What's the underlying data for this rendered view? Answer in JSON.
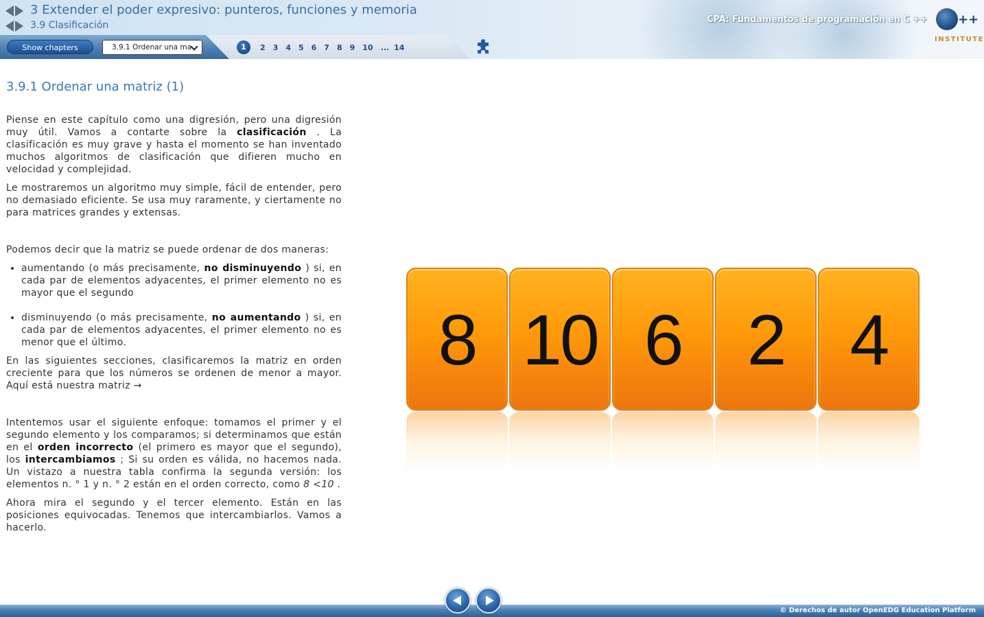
{
  "header": {
    "chapter_title": "3 Extender el poder expresivo: punteros, funciones y memoria",
    "section_title": "3.9 Clasificación",
    "course_title": "CPA: Fundamentos de programación en C ++",
    "logo_text": "INSTITUTE",
    "logo_plus": "++"
  },
  "toolbar": {
    "show_chapters_label": "Show chapters",
    "section_select_value": "3.9.1 Ordenar una ma",
    "pages": [
      "1",
      "2",
      "3",
      "4",
      "5",
      "6",
      "7",
      "8",
      "9",
      "10",
      "...",
      "14"
    ],
    "active_page": "1"
  },
  "content": {
    "title": "3.9.1 Ordenar una matriz (1)",
    "p1_a": "Piense en este capítulo como una digresión, pero una digresión muy útil. Vamos a contarte sobre la ",
    "p1_b": "clasificación",
    "p1_c": " . La clasificación es muy grave y hasta el momento se han inventado muchos algoritmos de clasificación que difieren mucho en velocidad y complejidad.",
    "p2": "Le mostraremos un algoritmo muy simple, fácil de entender, pero no demasiado eficiente. Se usa muy raramente, y ciertamente no para matrices grandes y extensas.",
    "p3": "Podemos decir que la matriz se puede ordenar de dos maneras:",
    "li1_a": "aumentando (o más precisamente, ",
    "li1_b": "no disminuyendo",
    "li1_c": " ) si, en cada par de elementos adyacentes, el primer elemento no es mayor que el segundo",
    "li2_a": "disminuyendo (o más precisamente, ",
    "li2_b": "no aumentando",
    "li2_c": " ) si, en cada par de elementos adyacentes, el primer elemento no es menor que el último.",
    "p4": "En las siguientes secciones, clasificaremos la matriz en orden creciente para que los números se ordenen de menor a mayor. Aquí está nuestra matriz →",
    "p5_a": "Intentemos usar el siguiente enfoque: tomamos el primer y el segundo elemento y los comparamos; si determinamos que están en el ",
    "p5_b": "orden incorrecto",
    "p5_c": " (el primero es mayor que el segundo), los ",
    "p5_d": "intercambiamos",
    "p5_e": " ; Si su orden es válida, no hacemos nada. Un vistazo a nuestra tabla confirma la segunda versión: los elementos n. ° 1 y n. ° 2 están en el orden correcto, como ",
    "p5_f": "8 <10",
    "p5_g": " .",
    "p6": "Ahora mira el segundo y el tercer elemento. Están en las posiciones equivocadas. Tenemos que intercambiarlos. Vamos a hacerlo."
  },
  "array_cards": [
    "8",
    "10",
    "6",
    "2",
    "4"
  ],
  "footer": {
    "copyright": "© Derechos de autor OpenEDG Education Platform"
  },
  "colors": {
    "card_orange": "#ff9a0a",
    "accent_blue": "#3c78b0",
    "toolbar_blue": "#4e7fb2"
  }
}
